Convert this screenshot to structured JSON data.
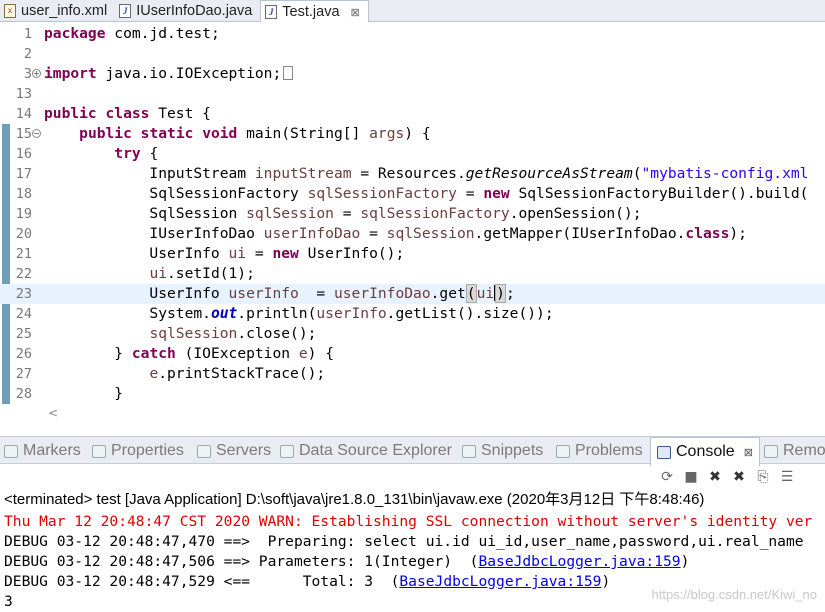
{
  "editor_tabs": [
    {
      "label": "user_info.xml",
      "icon": "xml-file-icon",
      "active": false
    },
    {
      "label": "IUserInfoDao.java",
      "icon": "java-file-icon",
      "active": false
    },
    {
      "label": "Test.java",
      "icon": "java-file-icon",
      "active": true,
      "close": "⊠"
    }
  ],
  "code_lines": [
    {
      "n": "1",
      "text": "package com.jd.test;"
    },
    {
      "n": "2",
      "text": ""
    },
    {
      "n": "3",
      "text": "import java.io.IOException;"
    },
    {
      "n": "13",
      "text": ""
    },
    {
      "n": "14",
      "text": "public class Test {"
    },
    {
      "n": "15",
      "text": "    public static void main(String[] args) {"
    },
    {
      "n": "16",
      "text": "        try {"
    },
    {
      "n": "17",
      "text": "            InputStream inputStream = Resources.getResourceAsStream(\"mybatis-config.xml"
    },
    {
      "n": "18",
      "text": "            SqlSessionFactory sqlSessionFactory = new SqlSessionFactoryBuilder().build("
    },
    {
      "n": "19",
      "text": "            SqlSession sqlSession = sqlSessionFactory.openSession();"
    },
    {
      "n": "20",
      "text": "            IUserInfoDao userInfoDao = sqlSession.getMapper(IUserInfoDao.class);"
    },
    {
      "n": "21",
      "text": "            UserInfo ui = new UserInfo();"
    },
    {
      "n": "22",
      "text": "            ui.setId(1);"
    },
    {
      "n": "23",
      "text": "            UserInfo userInfo  = userInfoDao.get(ui);"
    },
    {
      "n": "24",
      "text": "            System.out.println(userInfo.getList().size());"
    },
    {
      "n": "25",
      "text": "            sqlSession.close();"
    },
    {
      "n": "26",
      "text": "        } catch (IOException e) {"
    },
    {
      "n": "27",
      "text": "            e.printStackTrace();"
    },
    {
      "n": "28",
      "text": "        }"
    }
  ],
  "view_tabs": [
    {
      "label": "Markers",
      "icon": "markers-icon"
    },
    {
      "label": "Properties",
      "icon": "properties-icon"
    },
    {
      "label": "Servers",
      "icon": "servers-icon"
    },
    {
      "label": "Data Source Explorer",
      "icon": "data-source-explorer-icon"
    },
    {
      "label": "Snippets",
      "icon": "snippets-icon"
    },
    {
      "label": "Problems",
      "icon": "problems-icon"
    },
    {
      "label": "Console",
      "icon": "console-icon",
      "active": true,
      "close": "⊠"
    },
    {
      "label": "Remo",
      "icon": "remote-systems-icon"
    }
  ],
  "console": {
    "status": "<terminated> test [Java Application] D:\\soft\\java\\jre1.8.0_131\\bin\\javaw.exe (2020年3月12日 下午8:48:46)",
    "lines": [
      {
        "text": "Thu Mar 12 20:48:47 CST 2020 WARN: Establishing SSL connection without server's identity ver",
        "level": "warn"
      },
      {
        "text": "DEBUG 03-12 20:48:47,470 ==>  Preparing: select ui.id ui_id,user_name,password,ui.real_name",
        "level": "debug"
      },
      {
        "text": "DEBUG 03-12 20:48:47,506 ==> Parameters: 1(Integer)  (",
        "link": "BaseJdbcLogger.java:159",
        "tail": ")",
        "level": "debug"
      },
      {
        "text": "DEBUG 03-12 20:48:47,529 <==      Total: 3  (",
        "link": "BaseJdbcLogger.java:159",
        "tail": ")",
        "level": "debug"
      },
      {
        "text": "3",
        "level": "output"
      }
    ]
  },
  "watermark": "https://blog.csdn.net/Kiwi_no",
  "colors": {
    "keyword": "#7f0055",
    "local_var": "#6a3e3e",
    "string": "#2a00ff",
    "warn": "#e00000",
    "current_line": "#e8f2fe"
  }
}
